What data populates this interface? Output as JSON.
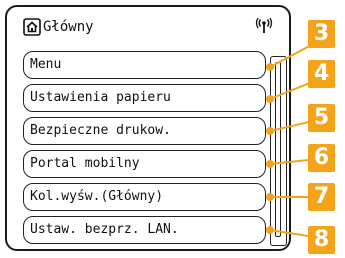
{
  "header": {
    "title": "Główny",
    "home_icon": "home-icon",
    "wireless_icon": "wireless-icon"
  },
  "menu": {
    "items": [
      {
        "label": "Menu",
        "callout": "3"
      },
      {
        "label": "Ustawienia papieru",
        "callout": "4"
      },
      {
        "label": "Bezpieczne drukow.",
        "callout": "5"
      },
      {
        "label": "Portal mobilny",
        "callout": "6"
      },
      {
        "label": "Kol.wyśw.(Główny)",
        "callout": "7"
      },
      {
        "label": "Ustaw. bezprz. LAN.",
        "callout": "8"
      }
    ]
  },
  "colors": {
    "callout": "#f5a319",
    "border": "#1a1a1a"
  }
}
